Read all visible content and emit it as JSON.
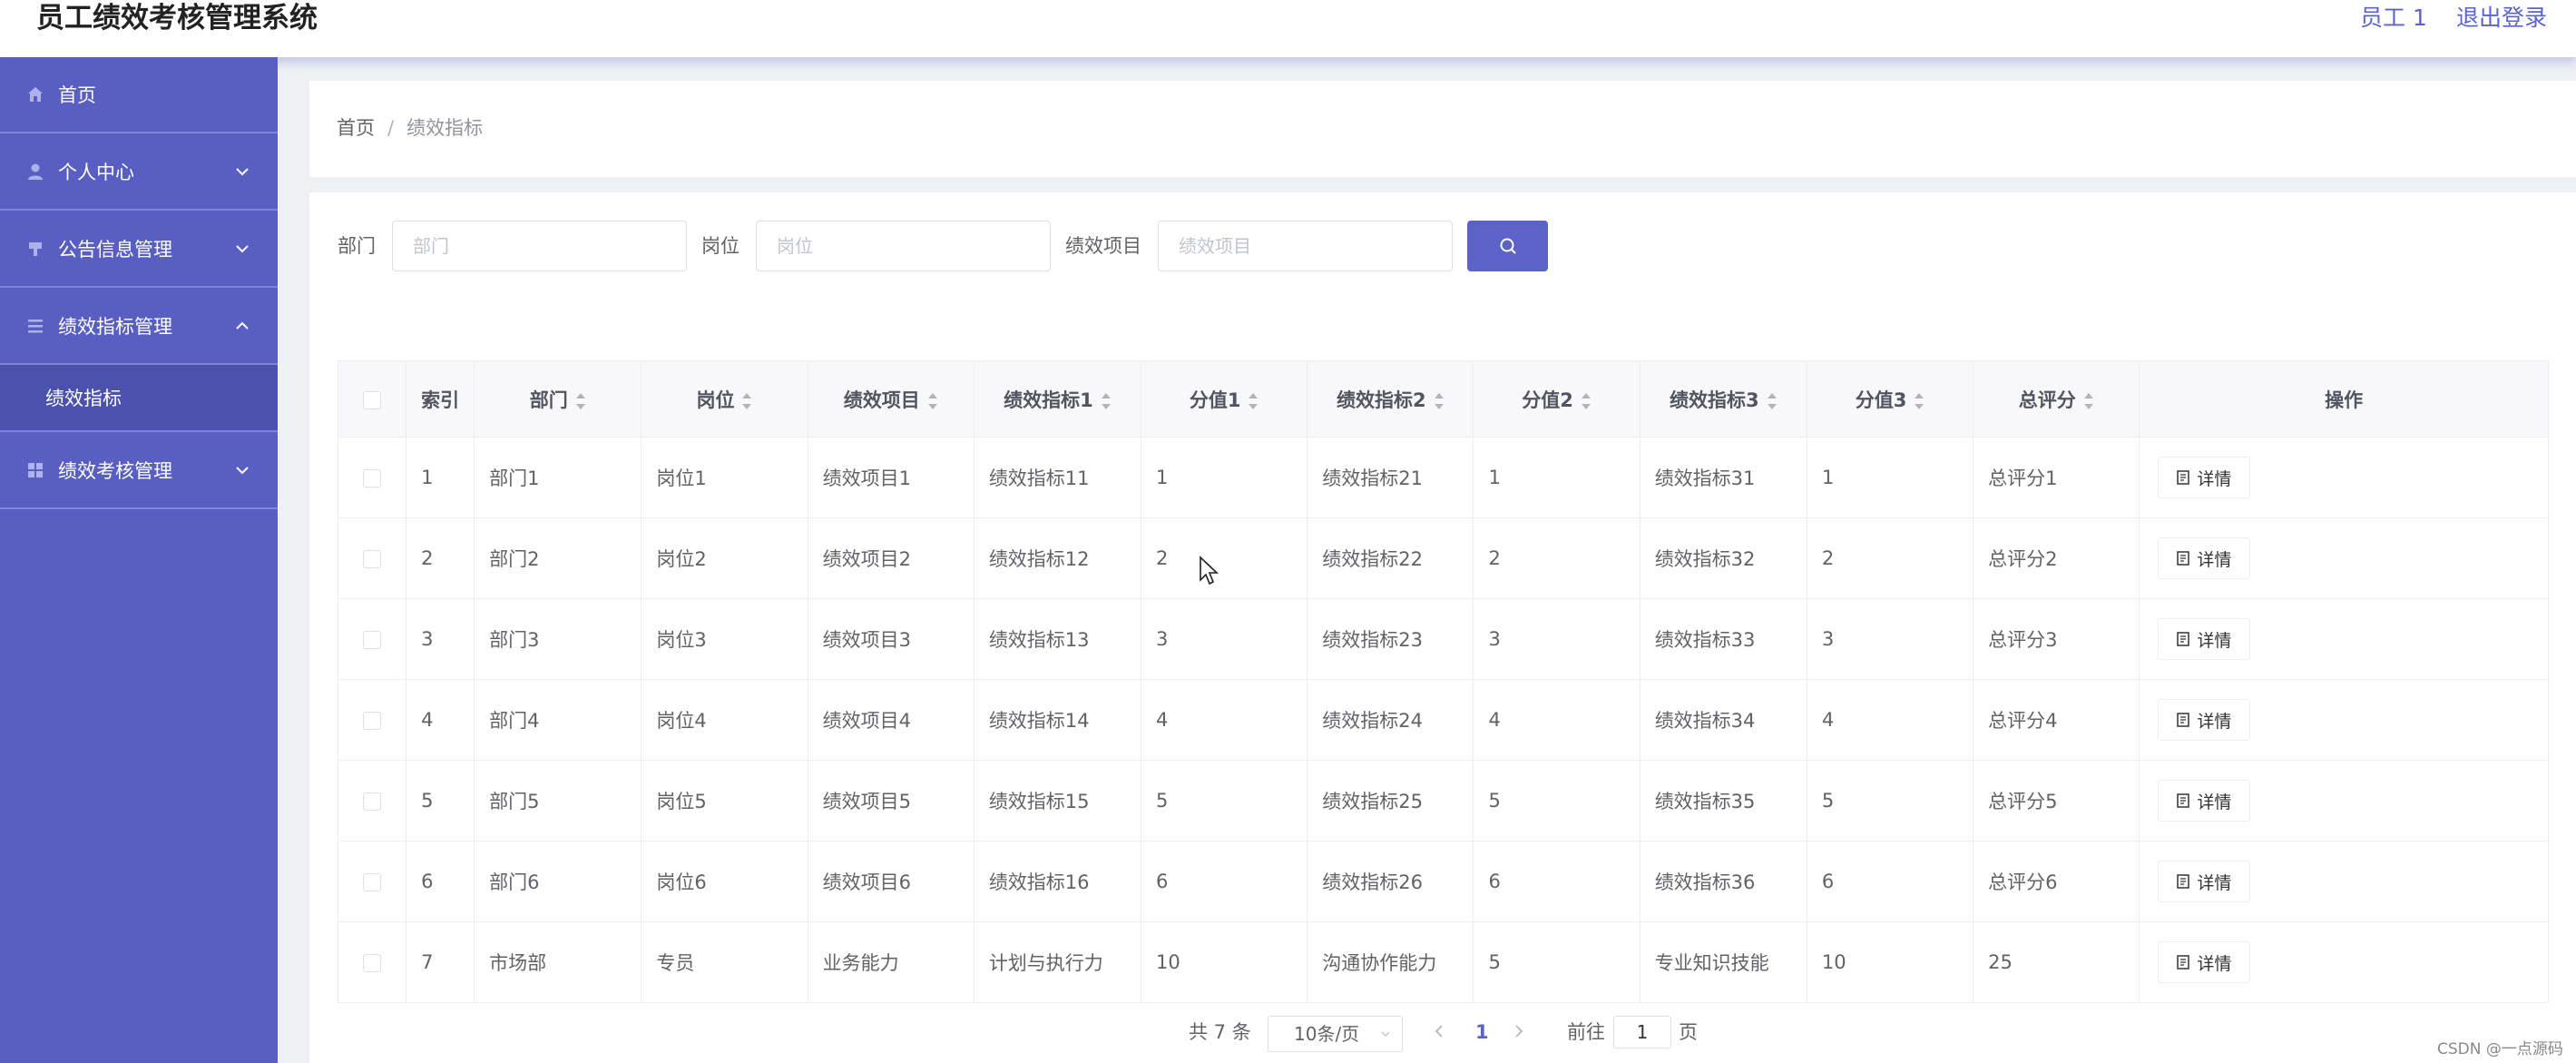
{
  "header": {
    "app_title": "员工绩效考核管理系统",
    "user_name": "员工 1",
    "logout": "退出登录"
  },
  "sidebar": {
    "items": [
      {
        "label": "首页",
        "icon": "home-icon"
      },
      {
        "label": "个人中心",
        "icon": "user-icon",
        "expanded": false
      },
      {
        "label": "公告信息管理",
        "icon": "notice-icon",
        "expanded": false
      },
      {
        "label": "绩效指标管理",
        "icon": "menu-icon",
        "expanded": true,
        "children": [
          "绩效指标"
        ]
      },
      {
        "label": "绩效考核管理",
        "icon": "grid-icon",
        "expanded": false
      }
    ]
  },
  "breadcrumb": {
    "home": "首页",
    "sep": "/",
    "current": "绩效指标"
  },
  "search": {
    "dept_label": "部门",
    "dept_placeholder": "部门",
    "post_label": "岗位",
    "post_placeholder": "岗位",
    "item_label": "绩效项目",
    "item_placeholder": "绩效项目"
  },
  "table": {
    "headers": [
      "索引",
      "部门",
      "岗位",
      "绩效项目",
      "绩效指标1",
      "分值1",
      "绩效指标2",
      "分值2",
      "绩效指标3",
      "分值3",
      "总评分",
      "操作"
    ],
    "detail_label": "详情",
    "rows": [
      [
        "1",
        "部门1",
        "岗位1",
        "绩效项目1",
        "绩效指标11",
        "1",
        "绩效指标21",
        "1",
        "绩效指标31",
        "1",
        "总评分1"
      ],
      [
        "2",
        "部门2",
        "岗位2",
        "绩效项目2",
        "绩效指标12",
        "2",
        "绩效指标22",
        "2",
        "绩效指标32",
        "2",
        "总评分2"
      ],
      [
        "3",
        "部门3",
        "岗位3",
        "绩效项目3",
        "绩效指标13",
        "3",
        "绩效指标23",
        "3",
        "绩效指标33",
        "3",
        "总评分3"
      ],
      [
        "4",
        "部门4",
        "岗位4",
        "绩效项目4",
        "绩效指标14",
        "4",
        "绩效指标24",
        "4",
        "绩效指标34",
        "4",
        "总评分4"
      ],
      [
        "5",
        "部门5",
        "岗位5",
        "绩效项目5",
        "绩效指标15",
        "5",
        "绩效指标25",
        "5",
        "绩效指标35",
        "5",
        "总评分5"
      ],
      [
        "6",
        "部门6",
        "岗位6",
        "绩效项目6",
        "绩效指标16",
        "6",
        "绩效指标26",
        "6",
        "绩效指标36",
        "6",
        "总评分6"
      ],
      [
        "7",
        "市场部",
        "专员",
        "业务能力",
        "计划与执行力",
        "10",
        "沟通协作能力",
        "5",
        "专业知识技能",
        "10",
        "25"
      ]
    ]
  },
  "pagination": {
    "total": "共 7 条",
    "page_size": "10条/页",
    "current_page": "1",
    "goto_prefix": "前往",
    "goto_value": "1",
    "goto_suffix": "页"
  },
  "watermark": "CSDN @一点源码",
  "colors": {
    "accent": "#5b63c9",
    "sidebar": "#595fc2",
    "submenu_active": "#4b51ad"
  }
}
